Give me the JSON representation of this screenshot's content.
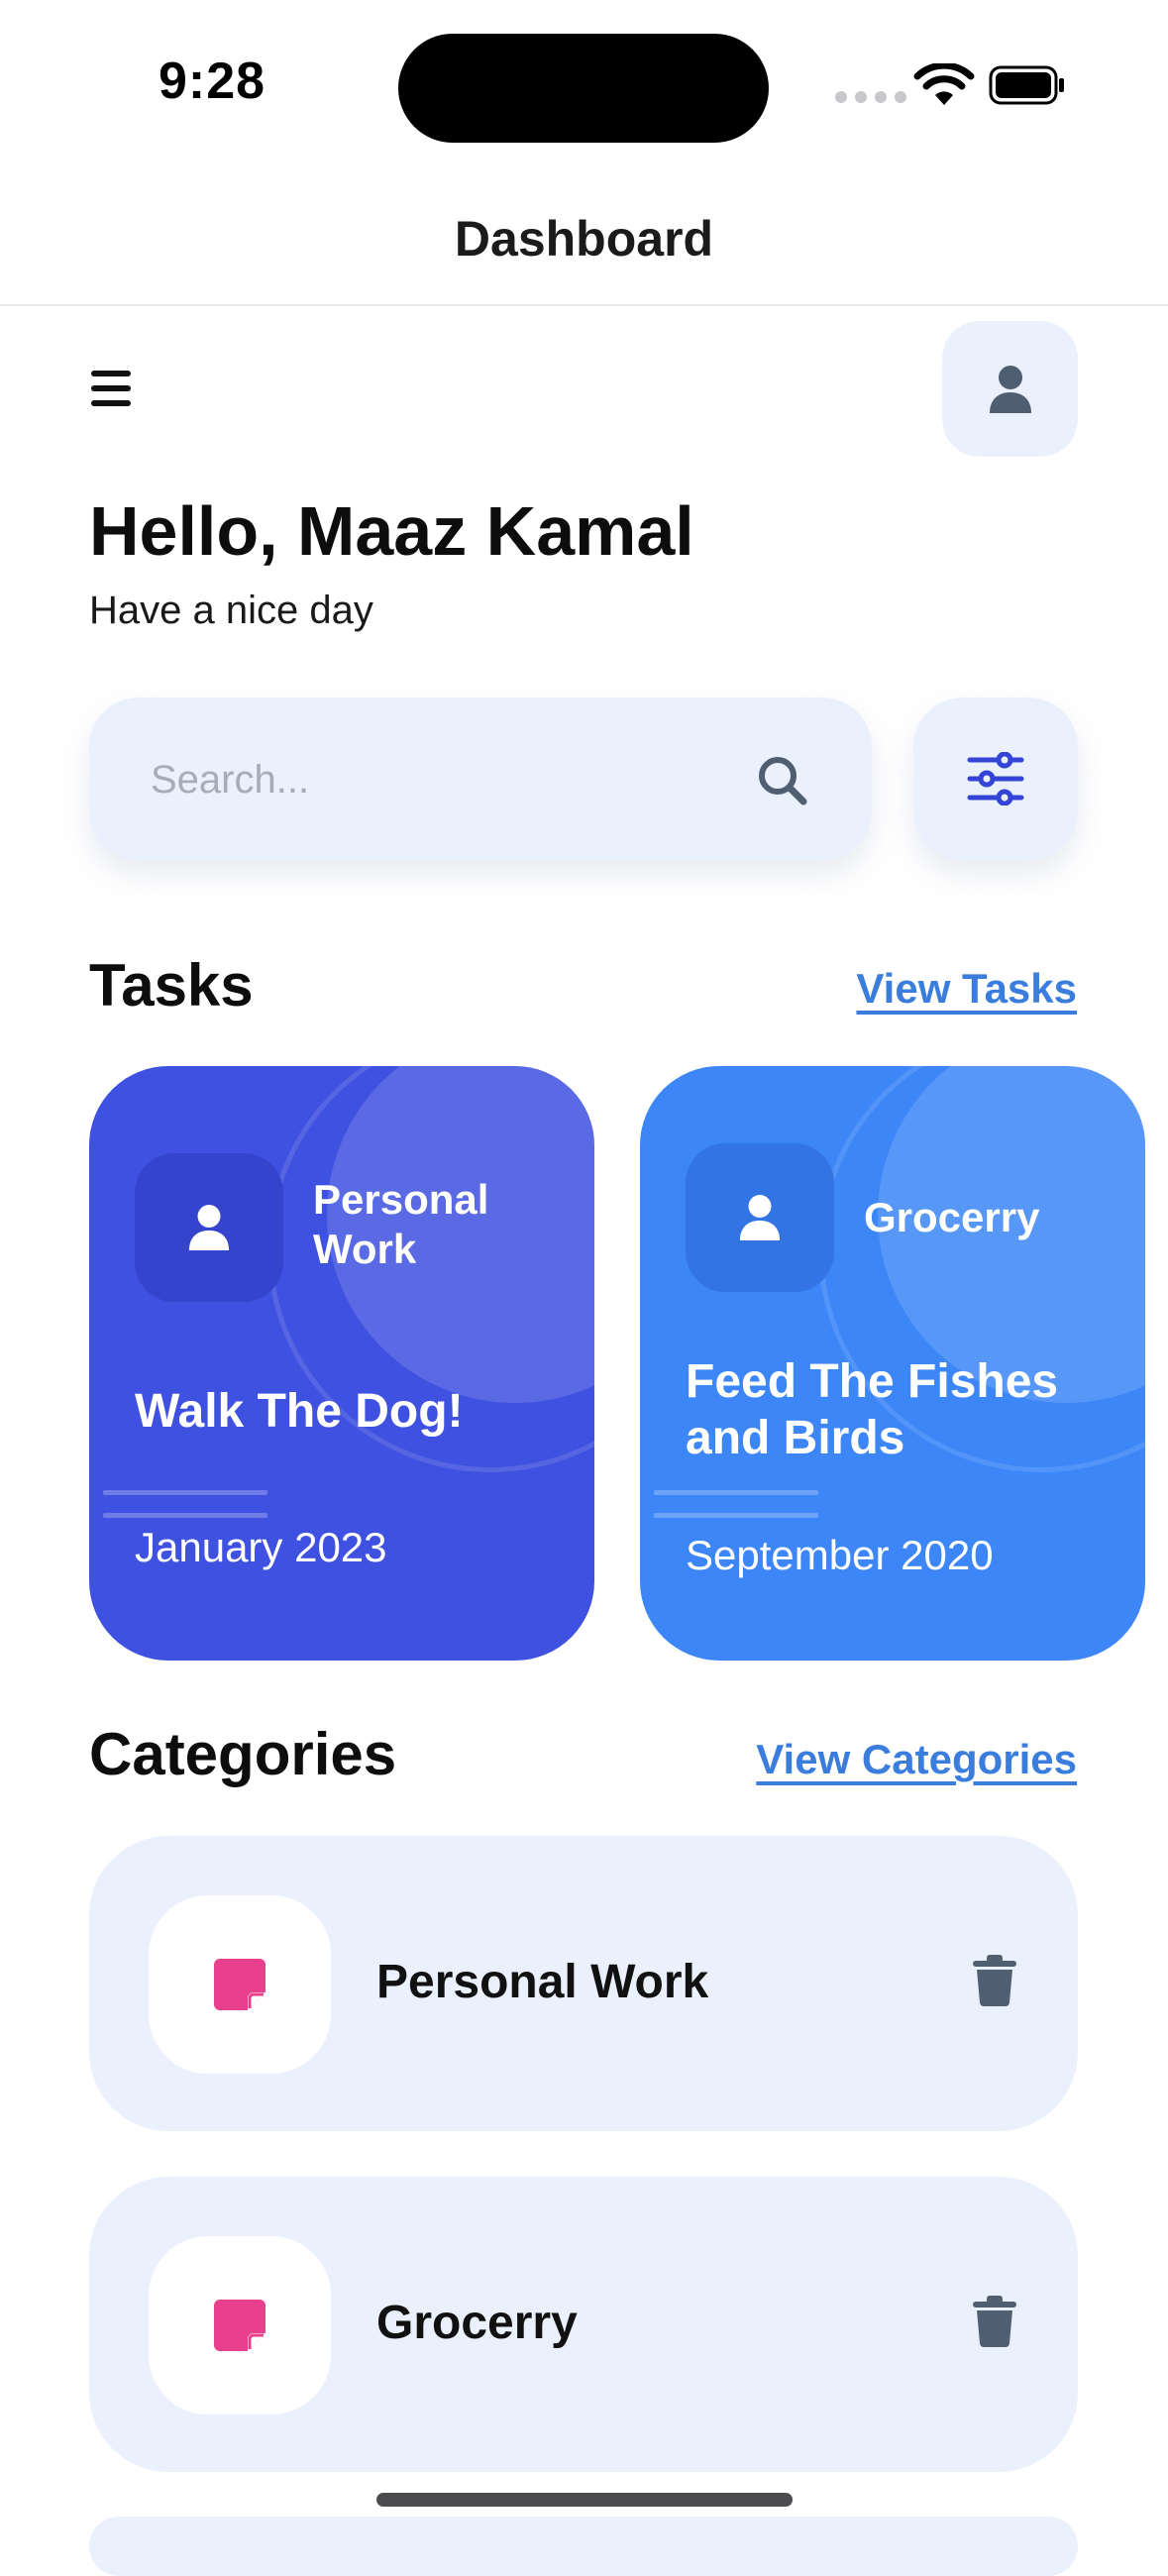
{
  "status_bar": {
    "time": "9:28"
  },
  "nav": {
    "title": "Dashboard"
  },
  "header": {
    "greeting": "Hello, Maaz Kamal",
    "subtitle": "Have a nice day"
  },
  "search": {
    "placeholder": "Search..."
  },
  "tasks": {
    "heading": "Tasks",
    "link": "View Tasks",
    "cards": [
      {
        "category": "Personal Work",
        "title": "Walk The Dog!",
        "date": "January 2023",
        "color": "#3f51e0"
      },
      {
        "category": "Grocerry",
        "title": "Feed The Fishes and Birds",
        "date": "September 2020",
        "color": "#3c86f7"
      }
    ]
  },
  "categories": {
    "heading": "Categories",
    "link": "View Categories",
    "items": [
      {
        "name": "Personal Work",
        "icon_color": "#e8408d"
      },
      {
        "name": "Grocerry",
        "icon_color": "#e8408d"
      }
    ]
  },
  "icons": {
    "menu": "menu-icon",
    "profile": "user-icon",
    "search": "search-icon",
    "filter": "sliders-icon",
    "category": "sticky-note-icon",
    "delete": "trash-icon"
  },
  "colors": {
    "accent_link": "#3b7ddd",
    "surface": "#eaf1fc",
    "filter_icon": "#3344d6"
  }
}
